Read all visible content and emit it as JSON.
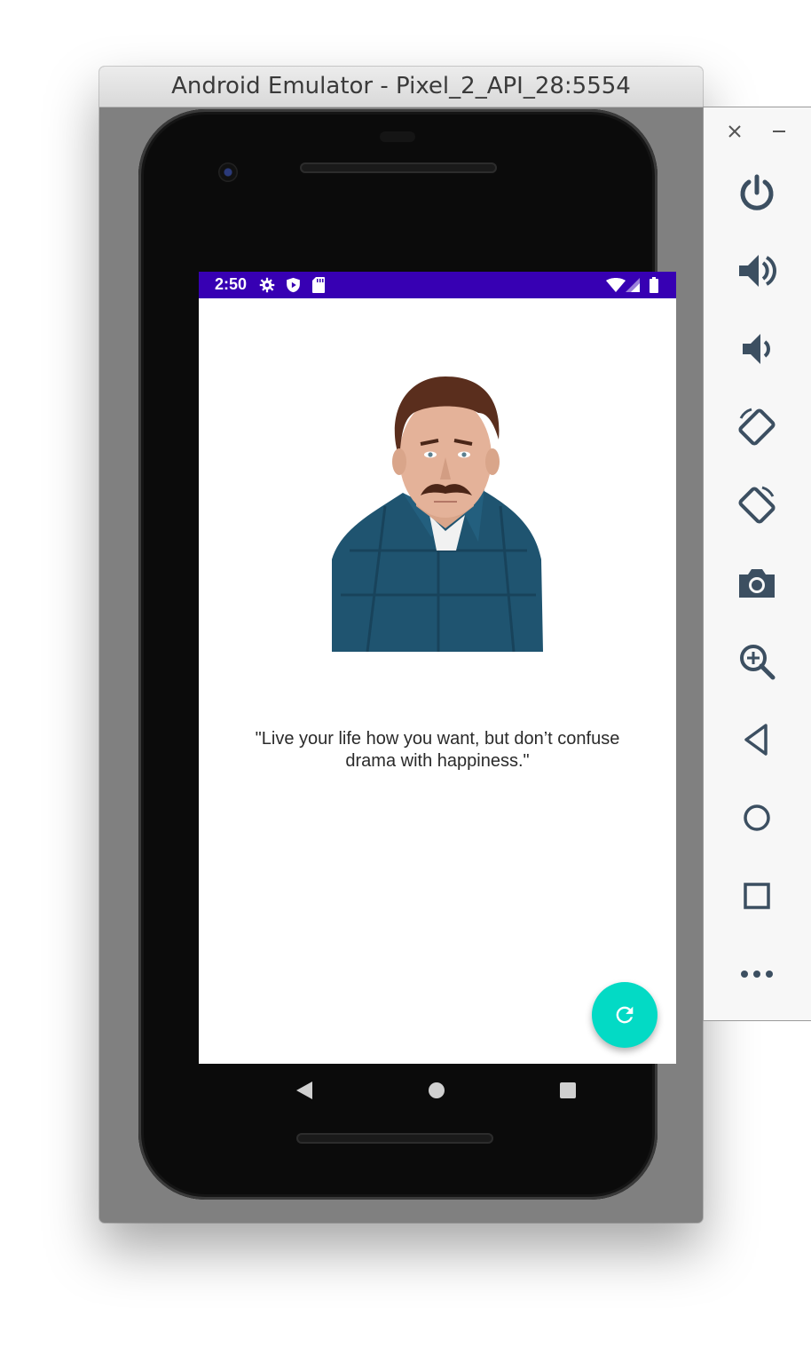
{
  "window": {
    "title": "Android Emulator - Pixel_2_API_28:5554"
  },
  "statusbar": {
    "time": "2:50",
    "left_icons": [
      "settings-icon",
      "shield-icon",
      "sd-card-icon"
    ],
    "right_icons": [
      "wifi-icon",
      "signal-icon",
      "battery-icon"
    ],
    "color": "#3700b3"
  },
  "app": {
    "quote": "\"Live your life how you want, but don’t confuse drama with happiness.\"",
    "fab_icon": "refresh-icon",
    "fab_color": "#03dac5"
  },
  "navbar": {
    "buttons": [
      "back-icon",
      "home-icon",
      "recents-icon"
    ]
  },
  "sidepanel": {
    "window_controls": [
      "close-icon",
      "minimize-icon"
    ],
    "tools": [
      "power-icon",
      "volume-up-icon",
      "volume-down-icon",
      "rotate-left-icon",
      "rotate-right-icon",
      "camera-icon",
      "zoom-icon",
      "back-icon",
      "home-icon",
      "overview-icon",
      "more-icon"
    ]
  }
}
